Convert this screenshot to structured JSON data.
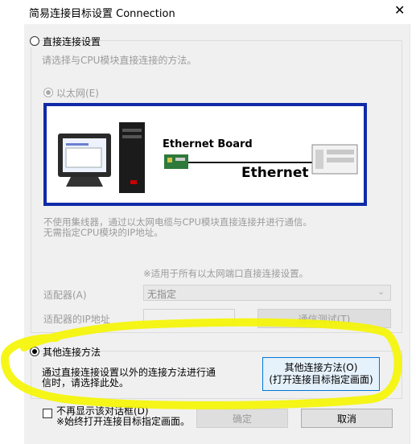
{
  "window": {
    "title": "简易连接目标设置 Connection",
    "close_glyph": "✕"
  },
  "direct": {
    "label": "直接连接设置",
    "description": "请选择与CPU模块直接连接的方法。",
    "ethernet_label": "以太网(E)",
    "diagram": {
      "board_label": "Ethernet Board",
      "network_label": "Ethernet"
    },
    "note": "不使用集线器，通过以太网电缆与CPU模块直接连接并进行通信。\n无需指定CPU模块的IP地址。",
    "applies_note": "※适用于所有以太网端口直接连接设置。",
    "adapter_label": "适配器(A)",
    "adapter_value": "无指定",
    "adapter_ip_label": "适配器的IP地址",
    "test_button": "通信测试(T)"
  },
  "other": {
    "label": "其他连接方法",
    "description": "通过直接连接设置以外的连接方法进行通\n信时，请选择此处。",
    "button": "其他连接方法(O)\n(打开连接目标指定画面)"
  },
  "footer": {
    "no_show_label": "不再显示该对话框(D)",
    "no_show_note": "※始终打开连接目标指定画面。",
    "ok": "确定",
    "cancel": "取消"
  },
  "colors": {
    "highlight": "#f5f500",
    "diagram_border": "#0f2aa8",
    "primary_border": "#0078d7"
  }
}
